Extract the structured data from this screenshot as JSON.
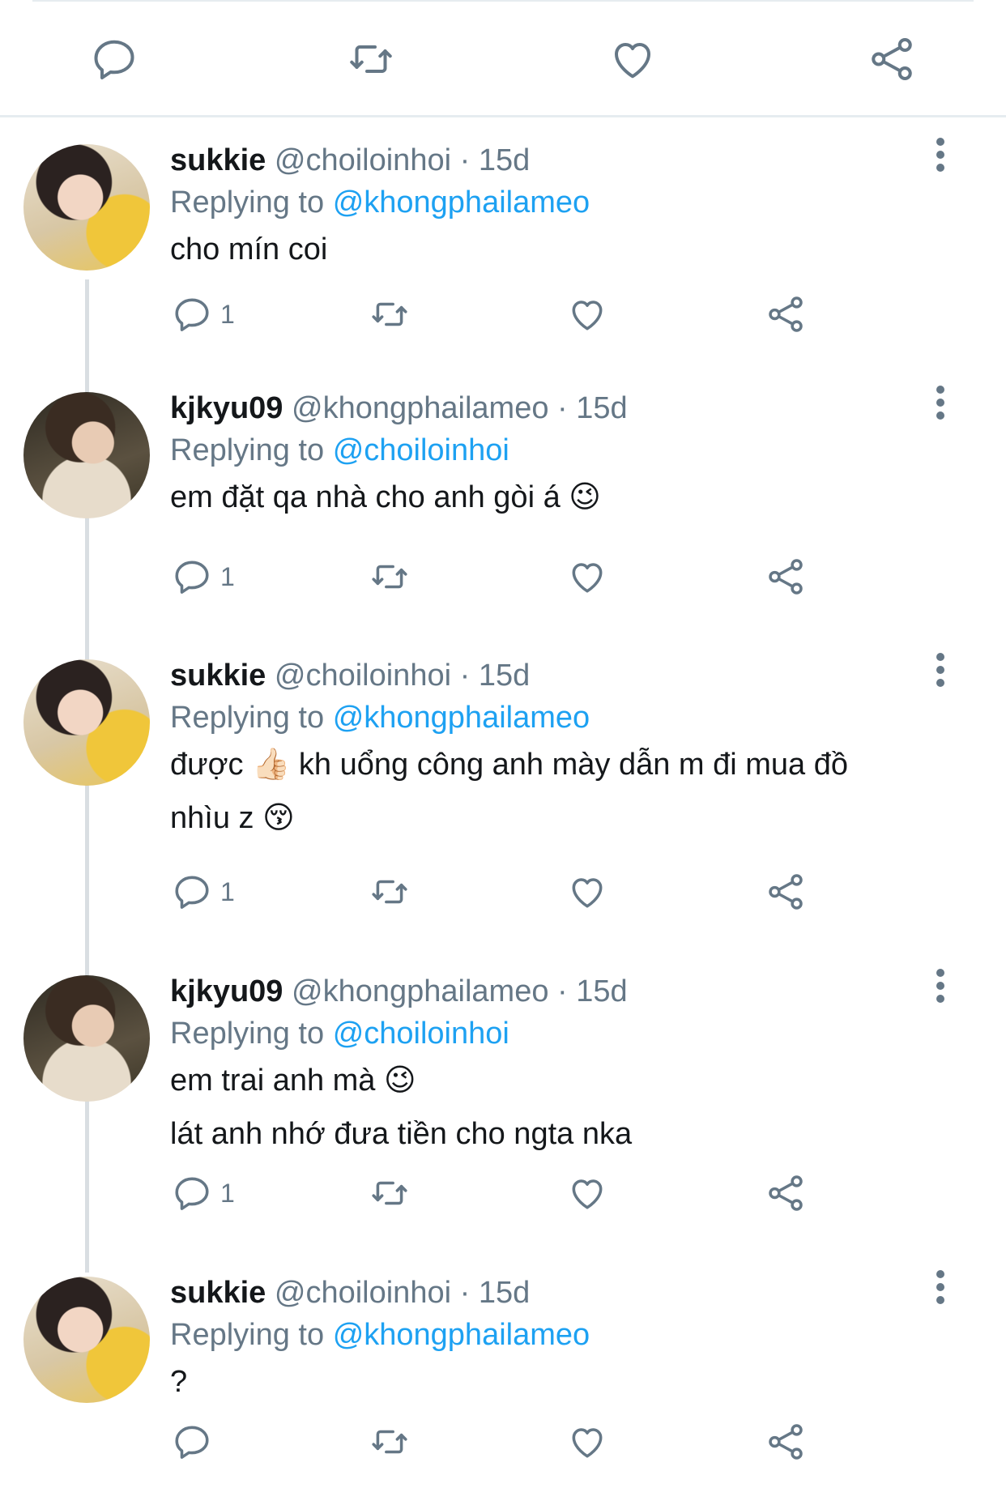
{
  "colors": {
    "link": "#1da1f2",
    "muted": "#657786",
    "text": "#14171a",
    "divider": "#e6ecf0"
  },
  "icons": {
    "reply": "reply-icon",
    "retweet": "retweet-icon",
    "like": "heart-icon",
    "share": "share-icon",
    "more": "more-vertical-icon"
  },
  "tweets": [
    {
      "name": "sukkie",
      "handle": "@choiloinhoi",
      "sep": "·",
      "time": "15d",
      "reply_prefix": "Replying to",
      "reply_to": "@khongphailameo",
      "lines": [
        "cho mín coi"
      ],
      "reply_count": "1"
    },
    {
      "name": "kjkyu09",
      "handle": "@khongphailameo",
      "sep": "·",
      "time": "15d",
      "reply_prefix": "Replying to",
      "reply_to": "@choiloinhoi",
      "lines": [
        "em đặt qa nhà cho anh gòi á 😉"
      ],
      "reply_count": "1"
    },
    {
      "name": "sukkie",
      "handle": "@choiloinhoi",
      "sep": "·",
      "time": "15d",
      "reply_prefix": "Replying to",
      "reply_to": "@khongphailameo",
      "lines": [
        "được 👍🏻  kh uổng công anh mày dẫn m đi mua đồ",
        "nhìu z 😚"
      ],
      "reply_count": "1"
    },
    {
      "name": "kjkyu09",
      "handle": "@khongphailameo",
      "sep": "·",
      "time": "15d",
      "reply_prefix": "Replying to",
      "reply_to": "@choiloinhoi",
      "lines": [
        "em trai anh mà 😉",
        "lát anh nhớ đưa tiền cho ngta nka"
      ],
      "reply_count": "1"
    },
    {
      "name": "sukkie",
      "handle": "@choiloinhoi",
      "sep": "·",
      "time": "15d",
      "reply_prefix": "Replying to",
      "reply_to": "@khongphailameo",
      "lines": [
        "?"
      ],
      "reply_count": ""
    }
  ]
}
